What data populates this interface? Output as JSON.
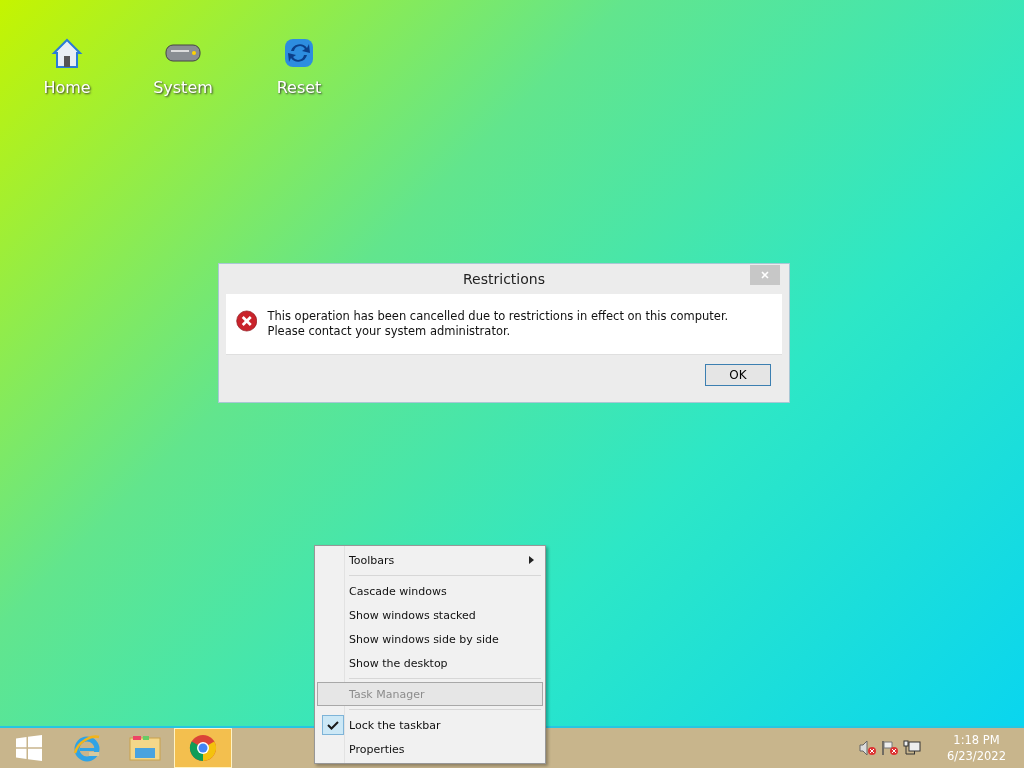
{
  "desktop_icons": [
    {
      "kind": "home",
      "label": "Home"
    },
    {
      "kind": "system",
      "label": "System"
    },
    {
      "kind": "reset",
      "label": "Reset"
    }
  ],
  "dialog": {
    "title": "Restrictions",
    "message": "This operation has been cancelled due to restrictions in effect on this computer. Please contact your system administrator.",
    "button": "OK"
  },
  "context_menu": [
    {
      "kind": "item",
      "label": "Toolbars",
      "submenu": true,
      "disabled": false,
      "checked": false,
      "selected": false
    },
    {
      "kind": "separator"
    },
    {
      "kind": "item",
      "label": "Cascade windows",
      "submenu": false,
      "disabled": false,
      "checked": false,
      "selected": false
    },
    {
      "kind": "item",
      "label": "Show windows stacked",
      "submenu": false,
      "disabled": false,
      "checked": false,
      "selected": false
    },
    {
      "kind": "item",
      "label": "Show windows side by side",
      "submenu": false,
      "disabled": false,
      "checked": false,
      "selected": false
    },
    {
      "kind": "item",
      "label": "Show the desktop",
      "submenu": false,
      "disabled": false,
      "checked": false,
      "selected": false
    },
    {
      "kind": "separator"
    },
    {
      "kind": "item",
      "label": "Task Manager",
      "submenu": false,
      "disabled": true,
      "checked": false,
      "selected": true
    },
    {
      "kind": "separator"
    },
    {
      "kind": "item",
      "label": "Lock the taskbar",
      "submenu": false,
      "disabled": false,
      "checked": true,
      "selected": false
    },
    {
      "kind": "item",
      "label": "Properties",
      "submenu": false,
      "disabled": false,
      "checked": false,
      "selected": false
    }
  ],
  "taskbar": {
    "apps": [
      {
        "kind": "start",
        "selected": false
      },
      {
        "kind": "ie",
        "selected": false
      },
      {
        "kind": "explorer",
        "selected": false
      },
      {
        "kind": "chrome",
        "selected": true
      }
    ],
    "clock": {
      "time": "1:18 PM",
      "date": "6/23/2022"
    }
  }
}
